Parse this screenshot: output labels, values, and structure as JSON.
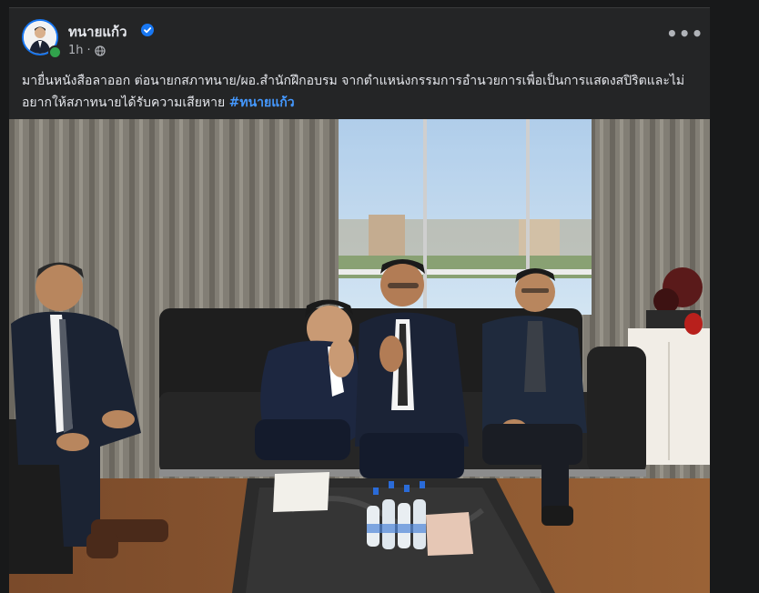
{
  "post": {
    "author": "ทนายแก้ว",
    "timestamp": "1h",
    "separator": "·",
    "privacy_icon": "globe-icon",
    "verified_icon": "verified-badge-icon",
    "more_label": "•••",
    "text_main": "มายื่นหนังสือลาออก ต่อนายกสภาทนาย/ผอ.สำนักฝึกอบรม จากตำแหน่งกรรมการอำนวยการเพื่อเป็นการแสดงสปิริตและไม่อยากให้สภาทนายได้รับความเสียหาย",
    "hashtag": "#ทนายแก้ว"
  },
  "colors": {
    "page_background": "#18191a",
    "card_background": "#242526",
    "primary_text": "#e4e6eb",
    "secondary_text": "#b0b3b8",
    "link": "#4599ff",
    "verified": "#1877f2",
    "online": "#31a24c"
  }
}
